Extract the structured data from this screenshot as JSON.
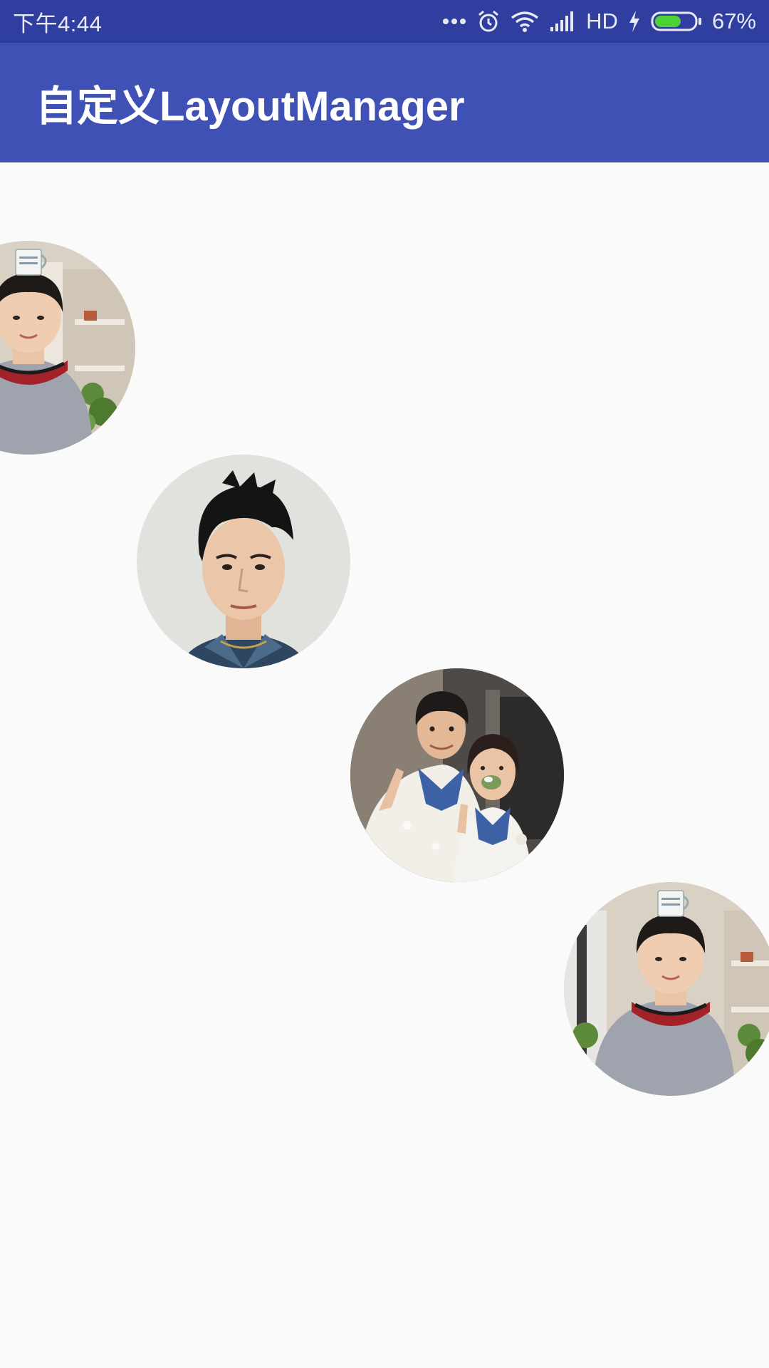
{
  "status_bar": {
    "time": "下午4:44",
    "icons": [
      "more-dots-icon",
      "alarm-icon",
      "wifi-icon",
      "signal-icon",
      "charging-icon",
      "battery-icon"
    ],
    "network_label": "HD",
    "battery_percent": "67%",
    "battery_level": 0.67,
    "battery_color": "#4cd137"
  },
  "app_bar": {
    "title": "自定义LayoutManager",
    "color": "#3f51b5",
    "status_color": "#303f9f"
  },
  "list": {
    "items": [
      {
        "photo": "boy-cup-on-head-photo"
      },
      {
        "photo": "boy-portrait-photo"
      },
      {
        "photo": "couple-cake-photo"
      },
      {
        "photo": "boy-cup-on-head-photo"
      }
    ]
  }
}
